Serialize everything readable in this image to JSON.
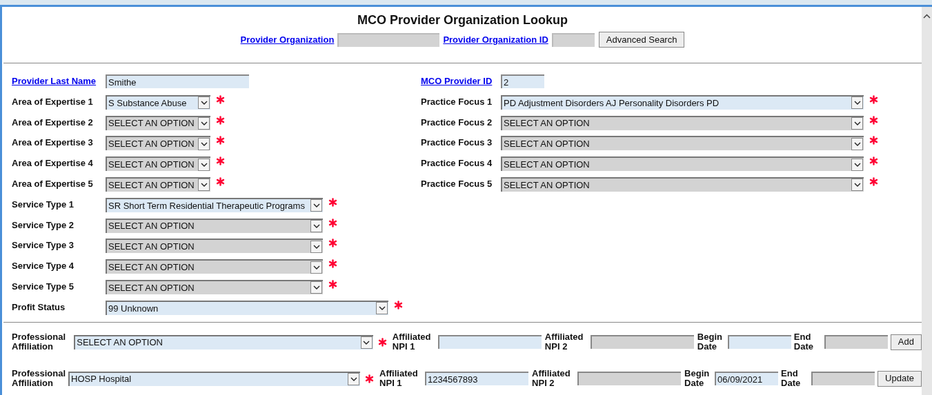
{
  "title": "MCO Provider Organization Lookup",
  "search": {
    "fields": [
      {
        "label": "Provider Organization",
        "disabled": true
      },
      {
        "label": "Provider Organization ID",
        "disabled": true
      }
    ],
    "button": "Advanced Search"
  },
  "left_column": [
    {
      "kind": "text",
      "label": "Provider Last Name",
      "link": true,
      "value": "Smithe",
      "disabled": false,
      "required": false
    },
    {
      "kind": "select",
      "label": "Area of Expertise 1",
      "link": false,
      "value": "S Substance Abuse",
      "disabled": false,
      "required": true
    },
    {
      "kind": "select",
      "label": "Area of Expertise 2",
      "link": false,
      "value": "SELECT AN OPTION",
      "disabled": true,
      "required": true
    },
    {
      "kind": "select",
      "label": "Area of Expertise 3",
      "link": false,
      "value": "SELECT AN OPTION",
      "disabled": true,
      "required": true
    },
    {
      "kind": "select",
      "label": "Area of Expertise 4",
      "link": false,
      "value": "SELECT AN OPTION",
      "disabled": true,
      "required": true
    },
    {
      "kind": "select",
      "label": "Area of Expertise 5",
      "link": false,
      "value": "SELECT AN OPTION",
      "disabled": true,
      "required": true
    },
    {
      "kind": "select",
      "label": "Service Type 1",
      "link": false,
      "value": "SR Short Term Residential Therapeutic Programs",
      "disabled": false,
      "required": true
    },
    {
      "kind": "select",
      "label": "Service Type 2",
      "link": false,
      "value": "SELECT AN OPTION",
      "disabled": true,
      "required": true
    },
    {
      "kind": "select",
      "label": "Service Type 3",
      "link": false,
      "value": "SELECT AN OPTION",
      "disabled": true,
      "required": true
    },
    {
      "kind": "select",
      "label": "Service Type 4",
      "link": false,
      "value": "SELECT AN OPTION",
      "disabled": true,
      "required": true
    },
    {
      "kind": "select",
      "label": "Service Type 5",
      "link": false,
      "value": "SELECT AN OPTION",
      "disabled": true,
      "required": true
    },
    {
      "kind": "select",
      "label": "Profit Status",
      "link": false,
      "value": "99 Unknown",
      "disabled": false,
      "required": true
    }
  ],
  "right_column": [
    {
      "kind": "text",
      "label": "MCO Provider ID",
      "link": true,
      "value": "2",
      "disabled": false,
      "required": false
    },
    {
      "kind": "select",
      "label": "Practice Focus 1",
      "link": false,
      "value": "PD Adjustment Disorders AJ Personality Disorders PD",
      "disabled": false,
      "required": true
    },
    {
      "kind": "select",
      "label": "Practice Focus 2",
      "link": false,
      "value": "SELECT AN OPTION",
      "disabled": true,
      "required": true
    },
    {
      "kind": "select",
      "label": "Practice Focus 3",
      "link": false,
      "value": "SELECT AN OPTION",
      "disabled": true,
      "required": true
    },
    {
      "kind": "select",
      "label": "Practice Focus 4",
      "link": false,
      "value": "SELECT AN OPTION",
      "disabled": true,
      "required": true
    },
    {
      "kind": "select",
      "label": "Practice Focus 5",
      "link": false,
      "value": "SELECT AN OPTION",
      "disabled": true,
      "required": true
    }
  ],
  "affiliations": [
    {
      "label": "Professional Affiliation",
      "value": "SELECT AN OPTION",
      "required": true,
      "fields": [
        {
          "label": "Affiliated NPI 1",
          "disabled": false
        },
        {
          "label": "Affiliated NPI 2",
          "disabled": true
        },
        {
          "label": "Begin Date",
          "disabled": false
        },
        {
          "label": "End Date",
          "disabled": true
        }
      ],
      "button": "Add"
    },
    {
      "label": "Professional Affiliation",
      "value": "HOSP Hospital",
      "required": true,
      "fields": [
        {
          "label": "Affiliated NPI 1",
          "value": "1234567893",
          "disabled": false
        },
        {
          "label": "Affiliated NPI 2",
          "disabled": true
        },
        {
          "label": "Begin Date",
          "value": "06/09/2021",
          "disabled": false
        },
        {
          "label": "End Date",
          "disabled": true
        }
      ],
      "button": "Update"
    }
  ]
}
